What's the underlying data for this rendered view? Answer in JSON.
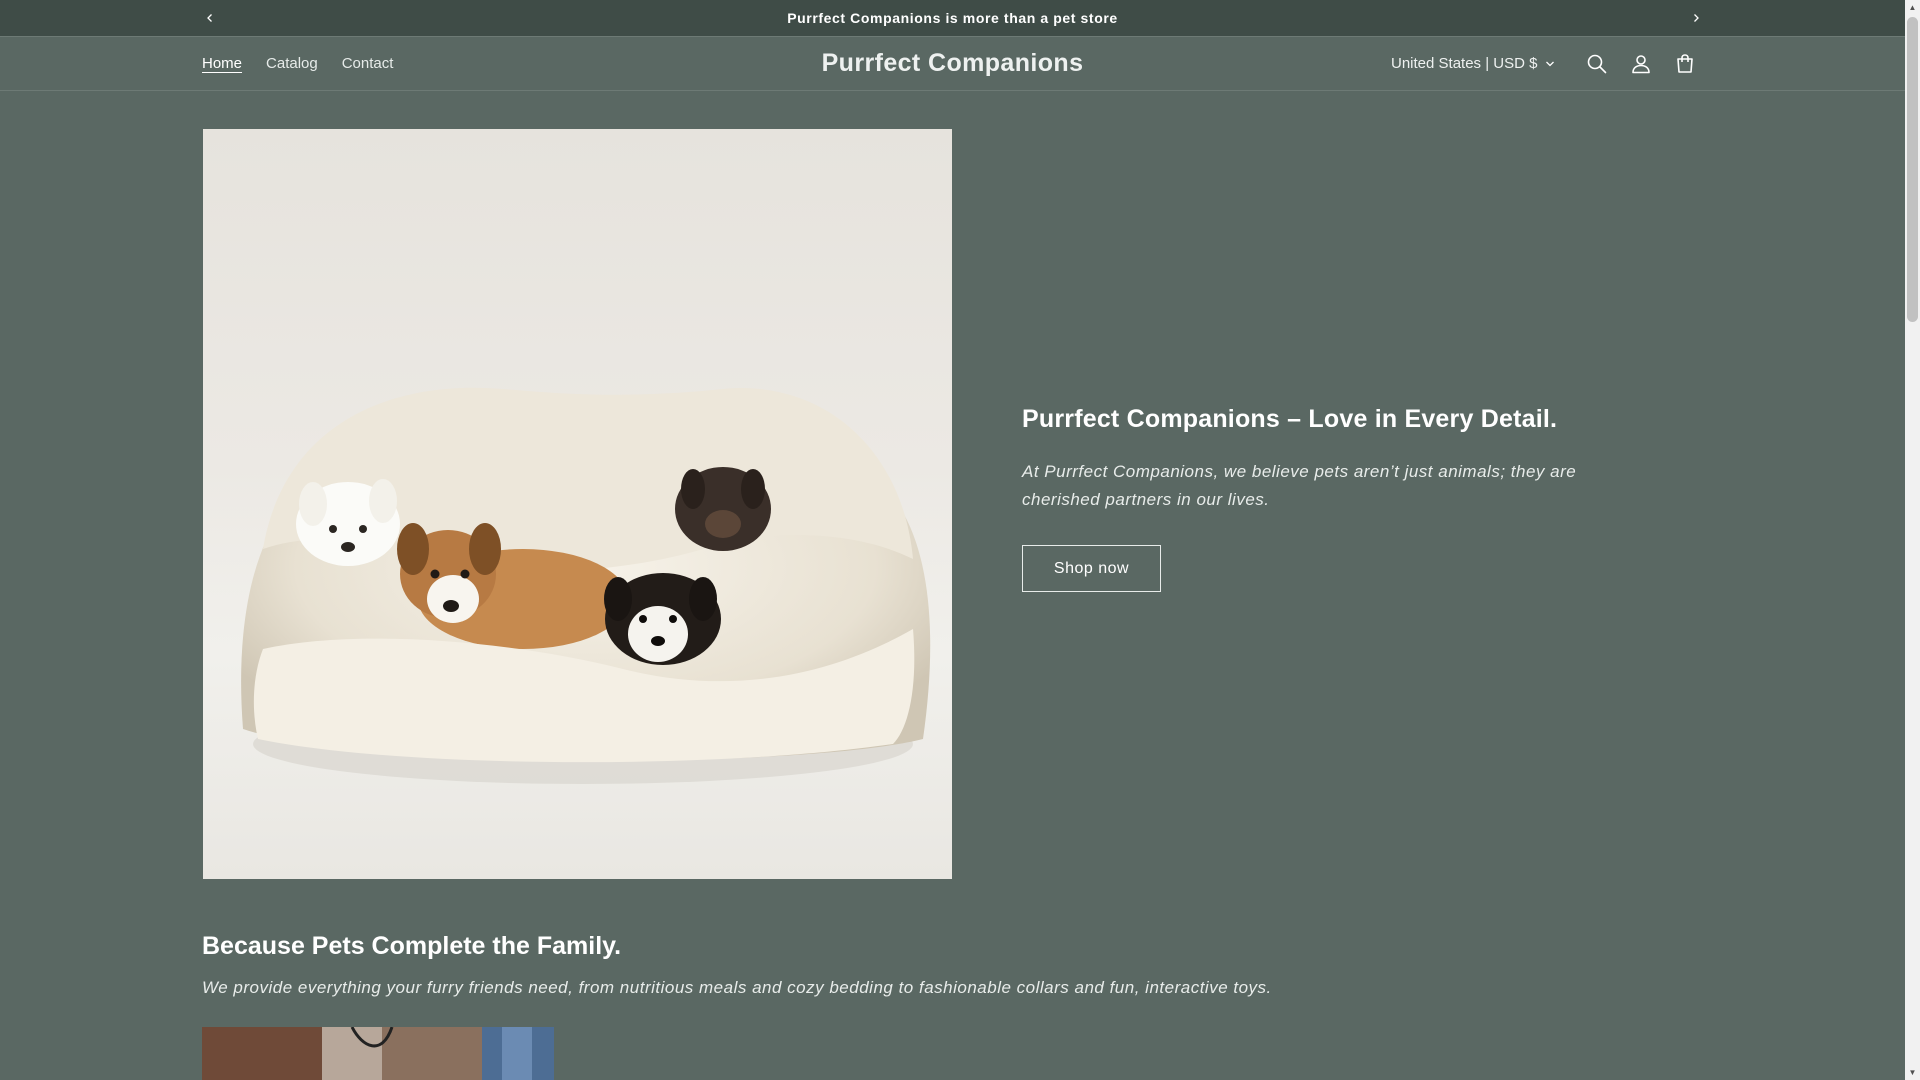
{
  "announcement": {
    "message": "Purrfect Companions is more than a pet store"
  },
  "header": {
    "nav": [
      {
        "label": "Home",
        "active": true
      },
      {
        "label": "Catalog",
        "active": false
      },
      {
        "label": "Contact",
        "active": false
      }
    ],
    "logo": "Purrfect Companions",
    "locale": "United States | USD $"
  },
  "hero": {
    "image_alt": "puppies in a cream pet bed",
    "title": "Purrfect Companions – Love in Every Detail.",
    "text": "At Purrfect Companions, we believe pets aren’t just animals; they are cherished partners in our lives.",
    "button": "Shop now"
  },
  "section": {
    "title": "Because Pets Complete the Family.",
    "text": "We provide everything your furry friends need, from nutritious meals and cozy bedding to fashionable collars and fun, interactive toys."
  },
  "icons": {
    "prev": "chevron-left-icon",
    "next": "chevron-right-icon",
    "search": "search-icon",
    "account": "account-icon",
    "cart": "cart-icon",
    "dropdown": "chevron-down-icon"
  },
  "colors": {
    "background": "#5a6863",
    "announcement_bg": "#3f4c47",
    "text": "#ffffff"
  }
}
